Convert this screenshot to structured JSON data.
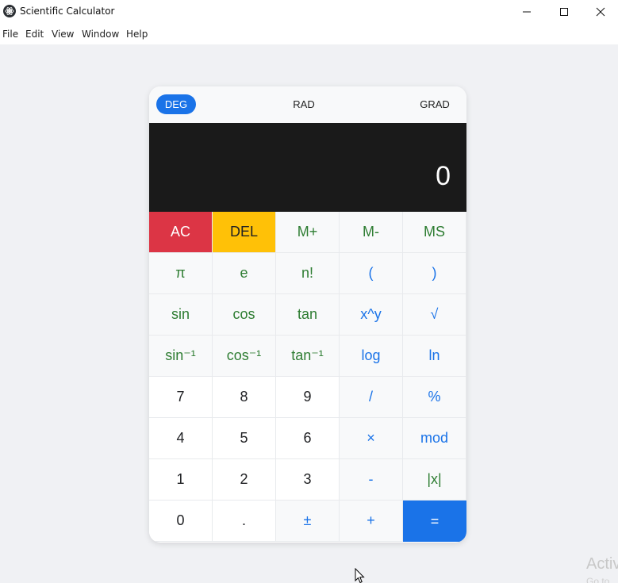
{
  "window": {
    "title": "Scientific Calculator"
  },
  "menu": {
    "file": "File",
    "edit": "Edit",
    "view": "View",
    "window": "Window",
    "help": "Help"
  },
  "modes": {
    "deg": "DEG",
    "rad": "RAD",
    "grad": "GRAD",
    "active": "DEG"
  },
  "display": {
    "value": "0"
  },
  "keys": {
    "ac": "AC",
    "del": "DEL",
    "mplus": "M+",
    "mminus": "M-",
    "ms": "MS",
    "pi": "π",
    "e": "e",
    "fact": "n!",
    "lparen": "(",
    "rparen": ")",
    "sin": "sin",
    "cos": "cos",
    "tan": "tan",
    "pow": "x^y",
    "sqrt": "√",
    "asin": "sin⁻¹",
    "acos": "cos⁻¹",
    "atan": "tan⁻¹",
    "log": "log",
    "ln": "ln",
    "n7": "7",
    "n8": "8",
    "n9": "9",
    "div": "/",
    "pct": "%",
    "n4": "4",
    "n5": "5",
    "n6": "6",
    "mul": "×",
    "mod": "mod",
    "n1": "1",
    "n2": "2",
    "n3": "3",
    "sub": "-",
    "abs": "|x|",
    "n0": "0",
    "dot": ".",
    "neg": "±",
    "add": "+",
    "eq": "="
  },
  "colors": {
    "accent": "#1a73e8",
    "clear": "#dc3545",
    "delete": "#ffc107",
    "display_bg": "#1a1a1a",
    "function_text": "#2e7d32"
  },
  "watermark": {
    "line1": "Activ",
    "line2": "Go to"
  }
}
